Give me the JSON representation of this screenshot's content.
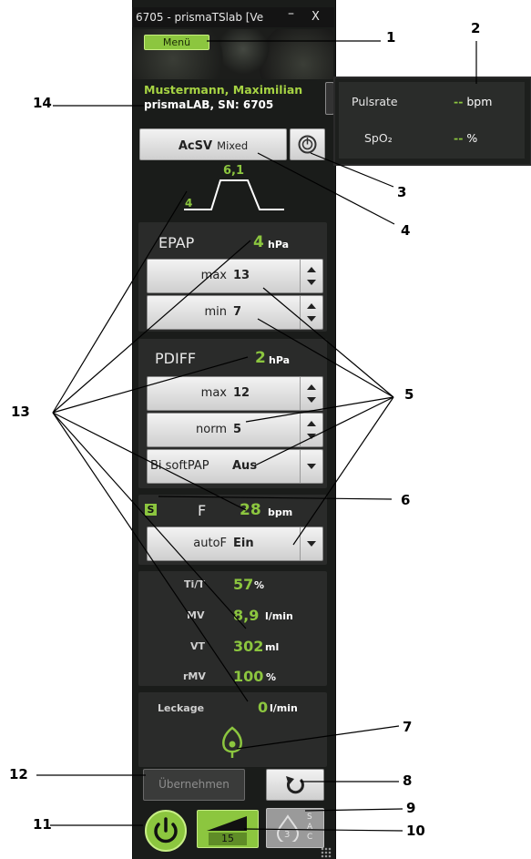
{
  "window": {
    "title": "6705 - prismaTSlab [Ve",
    "minimize": "–",
    "close": "X"
  },
  "menu": {
    "label": "Menü"
  },
  "patient": {
    "name": "Mustermann, Maximilian",
    "device": "prismaLAB, SN: 6705"
  },
  "monitor": {
    "pulse_label": "Pulsrate",
    "pulse_value": "--",
    "pulse_unit": "bpm",
    "spo2_label": "SpO₂",
    "spo2_value": "--",
    "spo2_unit": "%"
  },
  "mode": {
    "name": "AcSV",
    "sub": "Mixed"
  },
  "waveform": {
    "low": "4",
    "high": "6,1"
  },
  "epap": {
    "title": "EPAP",
    "value": "4",
    "unit": "hPa",
    "max_label": "max",
    "max_value": "13",
    "min_label": "min",
    "min_value": "7"
  },
  "pdiff": {
    "title": "PDIFF",
    "value": "2",
    "unit": "hPa",
    "max_label": "max",
    "max_value": "12",
    "norm_label": "norm",
    "norm_value": "5",
    "softpap_label": "Bi softPAP",
    "softpap_value": "Aus"
  },
  "freq": {
    "badge": "S",
    "title": "F",
    "value": "28",
    "unit": "bpm",
    "autof_label": "autoF",
    "autof_value": "Ein"
  },
  "measurements": [
    {
      "label": "Ti/T",
      "value": "57",
      "unit": "%"
    },
    {
      "label": "MV",
      "value": "8,9",
      "unit": "l/min"
    },
    {
      "label": "VT",
      "value": "302",
      "unit": "ml"
    },
    {
      "label": "rMV",
      "value": "100",
      "unit": "%"
    }
  ],
  "leak": {
    "label": "Leckage",
    "value": "0",
    "unit": "l/min"
  },
  "buttons": {
    "apply": "Übernehmen",
    "ramp_value": "15",
    "sac": "S A C"
  },
  "callouts": [
    "1",
    "2",
    "3",
    "4",
    "5",
    "6",
    "7",
    "8",
    "9",
    "10",
    "11",
    "12",
    "13",
    "14"
  ],
  "colors": {
    "accent": "#8cc63f",
    "panel": "#1a1c1a"
  }
}
